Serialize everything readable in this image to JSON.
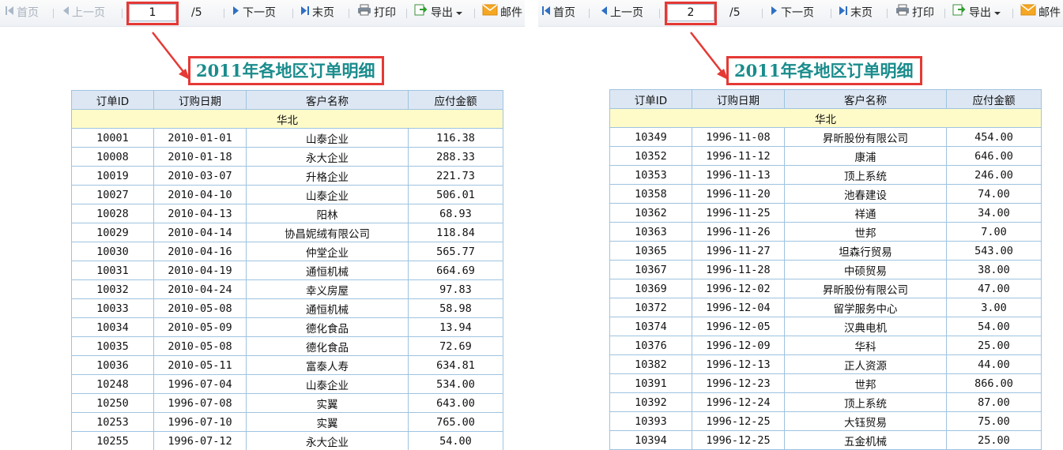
{
  "panels": [
    {
      "toolbar": {
        "first": "首页",
        "prev": "上一页",
        "page": "1",
        "total": "/5",
        "next": "下一页",
        "last": "末页",
        "print": "打印",
        "export": "导出",
        "mail": "邮件"
      },
      "report": {
        "title": "2011年各地区订单明细",
        "headers": [
          "订单ID",
          "订购日期",
          "客户名称",
          "应付金额"
        ],
        "region": "华北",
        "rows": [
          [
            "10001",
            "2010-01-01",
            "山泰企业",
            "116.38"
          ],
          [
            "10008",
            "2010-01-18",
            "永大企业",
            "288.33"
          ],
          [
            "10019",
            "2010-03-07",
            "升格企业",
            "221.73"
          ],
          [
            "10027",
            "2010-04-10",
            "山泰企业",
            "506.01"
          ],
          [
            "10028",
            "2010-04-13",
            "阳林",
            "68.93"
          ],
          [
            "10029",
            "2010-04-14",
            "协昌妮绒有限公司",
            "118.84"
          ],
          [
            "10030",
            "2010-04-16",
            "仲堂企业",
            "565.77"
          ],
          [
            "10031",
            "2010-04-19",
            "通恒机械",
            "664.69"
          ],
          [
            "10032",
            "2010-04-24",
            "幸义房屋",
            "97.83"
          ],
          [
            "10033",
            "2010-05-08",
            "通恒机械",
            "58.98"
          ],
          [
            "10034",
            "2010-05-09",
            "德化食品",
            "13.94"
          ],
          [
            "10035",
            "2010-05-08",
            "德化食品",
            "72.69"
          ],
          [
            "10036",
            "2010-05-11",
            "富泰人寿",
            "634.81"
          ],
          [
            "10248",
            "1996-07-04",
            "山泰企业",
            "534.00"
          ],
          [
            "10250",
            "1996-07-08",
            "实翼",
            "643.00"
          ],
          [
            "10253",
            "1996-07-10",
            "实翼",
            "765.00"
          ],
          [
            "10255",
            "1996-07-12",
            "永大企业",
            "54.00"
          ]
        ]
      }
    },
    {
      "toolbar": {
        "first": "首页",
        "prev": "上一页",
        "page": "2",
        "total": "/5",
        "next": "下一页",
        "last": "末页",
        "print": "打印",
        "export": "导出",
        "mail": "邮件"
      },
      "report": {
        "title": "2011年各地区订单明细",
        "headers": [
          "订单ID",
          "订购日期",
          "客户名称",
          "应付金额"
        ],
        "region": "华北",
        "rows": [
          [
            "10349",
            "1996-11-08",
            "昇昕股份有限公司",
            "454.00"
          ],
          [
            "10352",
            "1996-11-12",
            "康浦",
            "646.00"
          ],
          [
            "10353",
            "1996-11-13",
            "顶上系统",
            "246.00"
          ],
          [
            "10358",
            "1996-11-20",
            "池春建设",
            "74.00"
          ],
          [
            "10362",
            "1996-11-25",
            "祥通",
            "34.00"
          ],
          [
            "10363",
            "1996-11-26",
            "世邦",
            "7.00"
          ],
          [
            "10365",
            "1996-11-27",
            "坦森行贸易",
            "543.00"
          ],
          [
            "10367",
            "1996-11-28",
            "中硕贸易",
            "38.00"
          ],
          [
            "10369",
            "1996-12-02",
            "昇昕股份有限公司",
            "47.00"
          ],
          [
            "10372",
            "1996-12-04",
            "留学服务中心",
            "3.00"
          ],
          [
            "10374",
            "1996-12-05",
            "汉典电机",
            "54.00"
          ],
          [
            "10376",
            "1996-12-09",
            "华科",
            "25.00"
          ],
          [
            "10382",
            "1996-12-13",
            "正人资源",
            "44.00"
          ],
          [
            "10391",
            "1996-12-23",
            "世邦",
            "866.00"
          ],
          [
            "10392",
            "1996-12-24",
            "顶上系统",
            "87.00"
          ],
          [
            "10393",
            "1996-12-25",
            "大钰贸易",
            "75.00"
          ],
          [
            "10394",
            "1996-12-25",
            "五金机械",
            "25.00"
          ]
        ]
      }
    }
  ],
  "colors": {
    "annotation": "#e53935",
    "title": "#1a8c8c",
    "header_bg": "#dde7f3",
    "region_bg": "#fffbc8",
    "grid": "#9ec3e0"
  }
}
